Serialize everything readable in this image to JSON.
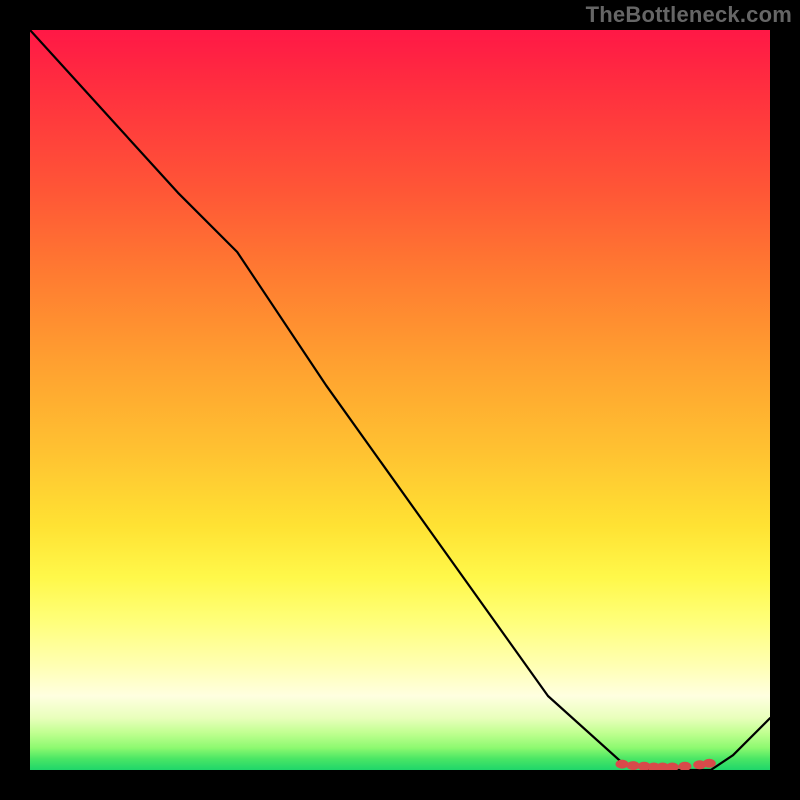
{
  "watermark": "TheBottleneck.com",
  "chart_data": {
    "type": "line",
    "title": "",
    "xlabel": "",
    "ylabel": "",
    "xlim": [
      0,
      100
    ],
    "ylim": [
      0,
      100
    ],
    "grid": false,
    "legend": false,
    "series": [
      {
        "name": "curve",
        "x": [
          0,
          10,
          20,
          28,
          40,
          55,
          70,
          80,
          84,
          88,
          92,
          95,
          100
        ],
        "y": [
          100,
          89,
          78,
          70,
          52,
          31,
          10,
          1,
          0,
          0,
          0,
          2,
          7
        ]
      }
    ],
    "markers": {
      "name": "bottom-cluster",
      "points": [
        {
          "x": 80.0,
          "y": 0.8
        },
        {
          "x": 81.5,
          "y": 0.6
        },
        {
          "x": 83.0,
          "y": 0.5
        },
        {
          "x": 84.3,
          "y": 0.4
        },
        {
          "x": 85.5,
          "y": 0.4
        },
        {
          "x": 86.8,
          "y": 0.4
        },
        {
          "x": 88.5,
          "y": 0.5
        },
        {
          "x": 90.5,
          "y": 0.7
        },
        {
          "x": 91.8,
          "y": 0.9
        }
      ]
    },
    "background_gradient": {
      "top": "#ff1846",
      "upper_mid": "#ffb231",
      "mid": "#fff84a",
      "lower_mid": "#ffffe0",
      "bottom": "#1fd66a"
    }
  }
}
